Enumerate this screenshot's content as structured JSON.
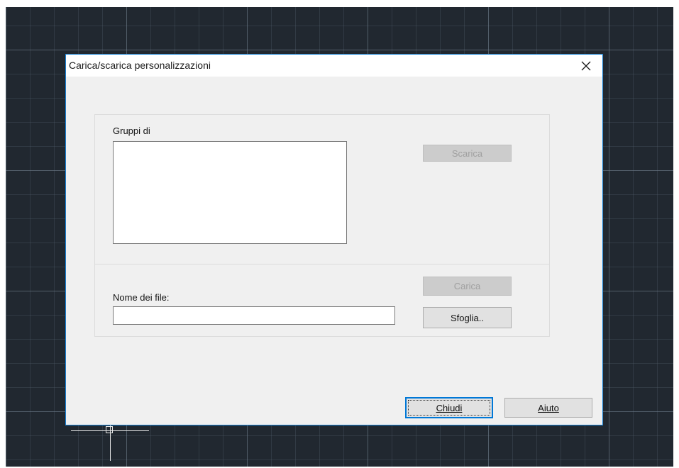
{
  "dialog": {
    "title": "Carica/scarica personalizzazioni",
    "close_symbol": "✕",
    "groups_label": "Gruppi di",
    "unload_label": "Scarica",
    "filename_label": "Nome dei file:",
    "filename_value": "",
    "load_label": "Carica",
    "browse_label": "Sfoglia..",
    "close_label": "Chiudi",
    "help_label": "Aiuto"
  },
  "colors": {
    "workspace_bg": "#212830",
    "dialog_border": "#1883d7",
    "default_button_border": "#0078d7"
  }
}
